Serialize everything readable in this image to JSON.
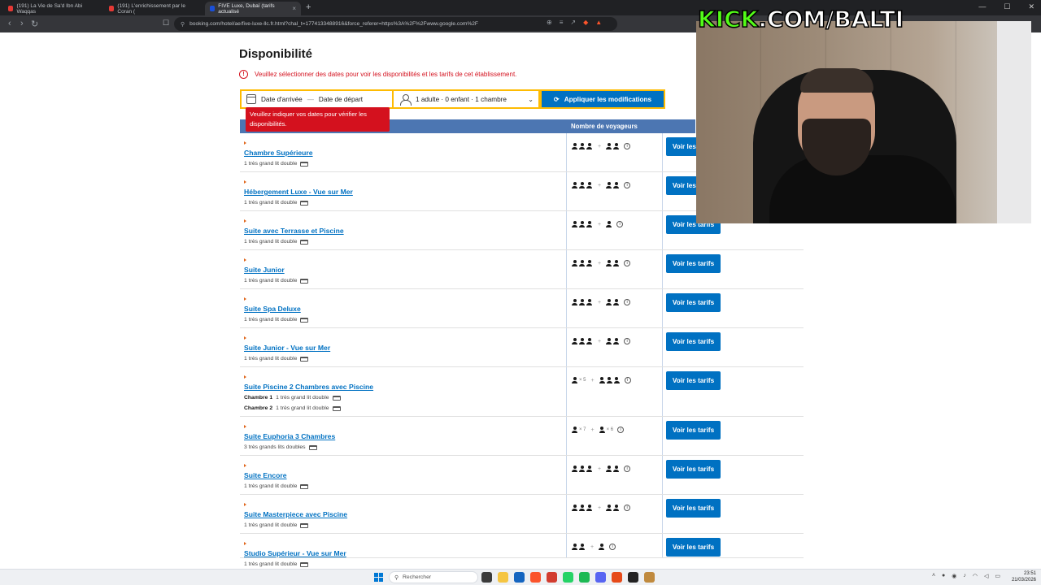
{
  "tabs": [
    {
      "label": "(191) La Vie de Sa'd Ibn Abi Waqqas",
      "active": false
    },
    {
      "label": "(191) L'enrichissement par le Coran (",
      "active": false
    },
    {
      "label": "FIVE Luxe, Dubaï (tarifs actualisé",
      "active": true
    }
  ],
  "url": "booking.com/hotel/ae/five-luxe-llc.fr.html?chal_t=1774133488916&force_referer=https%3A%2F%2Fwww.google.com%2F",
  "page": {
    "heading": "Disponibilité",
    "warning": "Veuillez sélectionner des dates pour voir les disponibilités et les tarifs de cet établissement.",
    "checkin_label": "Date d'arrivée",
    "checkout_label": "Date de départ",
    "date_separator": "—",
    "guests": "1 adulte · 0 enfant · 1 chambre",
    "apply_label": "Appliquer les modifications",
    "tooltip": "Veuillez indiquer vos dates pour vérifier les disponibilités.",
    "col_guests": "Nombre de voyageurs",
    "price_label": "Voir les tarifs",
    "rooms": [
      {
        "name": "Chambre Supérieure",
        "beds": [
          {
            "room": "",
            "bed": "1 très grand lit double"
          }
        ],
        "occ": {
          "a": 3,
          "b": 2
        }
      },
      {
        "name": "Hébergement Luxe - Vue sur Mer",
        "beds": [
          {
            "room": "",
            "bed": "1 très grand lit double"
          }
        ],
        "occ": {
          "a": 3,
          "b": 2
        }
      },
      {
        "name": "Suite avec Terrasse et Piscine",
        "beds": [
          {
            "room": "",
            "bed": "1 très grand lit double"
          }
        ],
        "occ": {
          "a": 3,
          "b": 1
        }
      },
      {
        "name": "Suite Junior",
        "beds": [
          {
            "room": "",
            "bed": "1 très grand lit double"
          }
        ],
        "occ": {
          "a": 3,
          "b": 2
        }
      },
      {
        "name": "Suite Spa Deluxe",
        "beds": [
          {
            "room": "",
            "bed": "1 très grand lit double"
          }
        ],
        "occ": {
          "a": 3,
          "b": 2
        }
      },
      {
        "name": "Suite Junior - Vue sur Mer",
        "beds": [
          {
            "room": "",
            "bed": "1 très grand lit double"
          }
        ],
        "occ": {
          "a": 3,
          "b": 2
        }
      },
      {
        "name": "Suite Piscine 2 Chambres avec Piscine",
        "beds": [
          {
            "room": "Chambre 1",
            "bed": "1 très grand lit double"
          },
          {
            "room": "Chambre 2",
            "bed": "1 très grand lit double"
          }
        ],
        "occ": {
          "a": 1,
          "amul": "× 5",
          "b": 3
        }
      },
      {
        "name": "Suite Euphoria 3 Chambres",
        "beds": [
          {
            "room": "",
            "bed": "3 très grands lits doubles"
          }
        ],
        "occ": {
          "a": 1,
          "amul": "× 7",
          "b": 1,
          "bmul": "× 6"
        }
      },
      {
        "name": "Suite Encore",
        "beds": [
          {
            "room": "",
            "bed": "1 très grand lit double"
          }
        ],
        "occ": {
          "a": 3,
          "b": 2
        }
      },
      {
        "name": "Suite Masterpiece avec Piscine",
        "beds": [
          {
            "room": "",
            "bed": "1 très grand lit double"
          }
        ],
        "occ": {
          "a": 3,
          "b": 2
        }
      },
      {
        "name": "Studio Supérieur - Vue sur Mer",
        "beds": [
          {
            "room": "",
            "bed": "1 très grand lit double"
          }
        ],
        "occ": {
          "a": 2,
          "b": 1
        }
      }
    ]
  },
  "overlay": {
    "kick_green": "KICK",
    "kick_white": ".COM/BALTI"
  },
  "taskbar": {
    "search_placeholder": "Rechercher",
    "time": "23:51",
    "date": "21/03/2026"
  },
  "colors": {
    "booking_blue": "#0071c2",
    "header_blue": "#4c76b2",
    "error_red": "#d4111e",
    "accent_yellow": "#febb02",
    "kick_green": "#53fc18"
  }
}
